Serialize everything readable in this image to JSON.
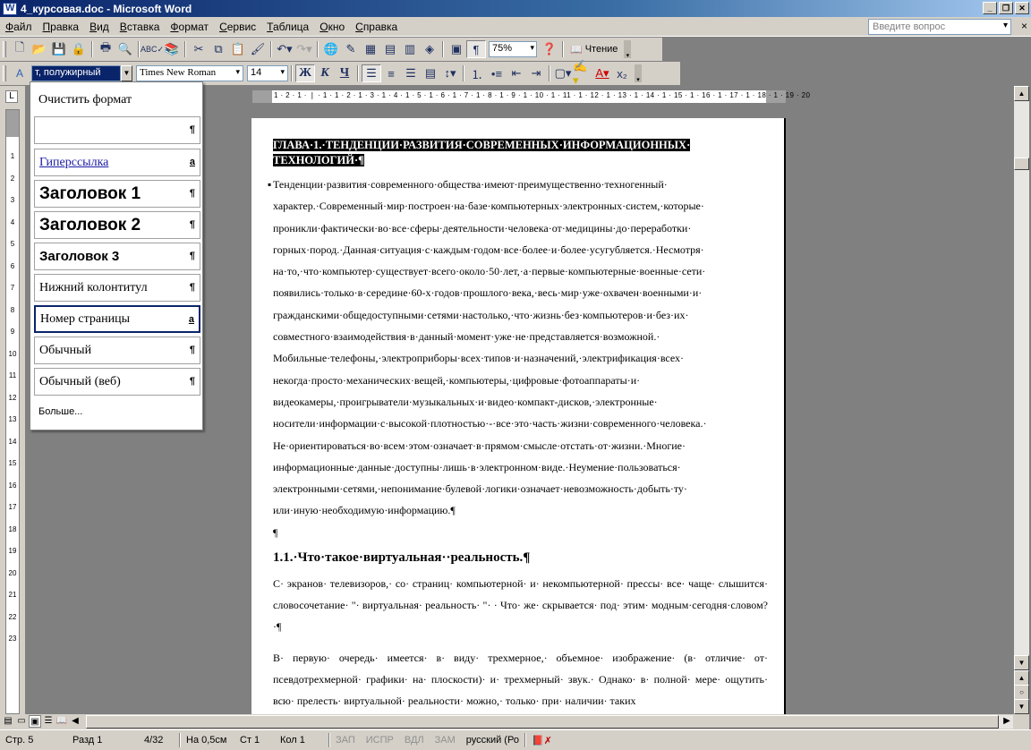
{
  "window": {
    "title": "4_курсовая.doc - Microsoft Word",
    "app_icon_letter": "W"
  },
  "menu": {
    "items": [
      "Файл",
      "Правка",
      "Вид",
      "Вставка",
      "Формат",
      "Сервис",
      "Таблица",
      "Окно",
      "Справка"
    ],
    "ask_placeholder": "Введите вопрос",
    "close_glyph": "×"
  },
  "standard_toolbar": {
    "zoom": "75%",
    "reading_label": "Чтение"
  },
  "format_toolbar": {
    "style_value": "т, полужирный",
    "font_name": "Times New Roman",
    "font_size": "14",
    "bold_letter": "Ж",
    "italic_letter": "К",
    "underline_letter": "Ч"
  },
  "style_panel": {
    "clear_label": "Очистить формат",
    "items": [
      {
        "label": "",
        "mark": "¶"
      },
      {
        "label": "Гиперссылка",
        "mark": "a"
      },
      {
        "label": "Заголовок 1",
        "mark": "¶"
      },
      {
        "label": "Заголовок 2",
        "mark": "¶"
      },
      {
        "label": "Заголовок 3",
        "mark": "¶"
      },
      {
        "label": "Нижний колонтитул",
        "mark": "¶"
      },
      {
        "label": "Номер страницы",
        "mark": "a"
      },
      {
        "label": "Обычный",
        "mark": "¶"
      },
      {
        "label": "Обычный (веб)",
        "mark": "¶"
      }
    ],
    "more_label": "Больше..."
  },
  "ruler": {
    "h_numbers": "1 · 2 · 1 · ❘ · 1 · 1 · 2 · 1 · 3 · 1 · 4 · 1 · 5 · 1 · 6 · 1 · 7 · 1 · 8 · 1 · 9 · 1 · 10 · 1 · 11 · 1 · 12 · 1 · 13 · 1 · 14 · 1 · 15 · 1 · 16 · 1 · 17 · 1 · 18 · 1 · 19 · 20",
    "v_numbers": [
      "1",
      "2",
      "3",
      "4",
      "5",
      "6",
      "7",
      "8",
      "9",
      "10",
      "11",
      "12",
      "13",
      "14",
      "15",
      "16",
      "17",
      "18",
      "19",
      "20",
      "21",
      "22",
      "23"
    ]
  },
  "document": {
    "chapter_title": "ГЛАВА·1.·ТЕНДЕНЦИИ·РАЗВИТИЯ·СОВРЕМЕННЫХ·ИНФОРМАЦИОННЫХ· ТЕХНОЛОГИЙ·¶",
    "para1": "Тенденции·развития·современного·общества·имеют·преимущественно·техногенный· характер.·Современный·мир·построен·на·базе·компьютерных·электронных·систем,·которые· проникли·фактически·во·все·сферы·деятельности·человека·от·медицины·до·переработки· горных·пород.·Данная·ситуация·с·каждым·годом·все·более·и·более·усугубляется.·Несмотря· на·то,·что·компьютер·существует·всего·около·50·лет,·а·первые·компьютерные·военные·сети· появились·только·в·середине·60-х·годов·прошлого·века,·весь·мир·уже·охвачен·военными·и· гражданскими·общедоступными·сетями·настолько,·что·жизнь·без·компьютеров·и·без·их· совместного·взаимодействия·в·данный·момент·уже·не·представляется·возможной.· Мобильные·телефоны,·электроприборы·всех·типов·и·назначений,·электрификация·всех· некогда·просто·механических·вещей,·компьютеры,·цифровые·фотоаппараты·и· видеокамеры,·проигрыватели·музыкальных·и·видео·компакт-дисков,·электронные· носители·информации·с·высокой·плотностью·-·все·это·часть·жизни·современного·человека.· Не·ориентироваться·во·всем·этом·означает·в·прямом·смысле·отстать·от·жизни.·Многие· информационные·данные·доступны·лишь·в·электронном·виде.·Неумение·пользоваться· электронными·сетями,·непонимание·булевой·логики·означает·невозможность·добыть·ту· или·иную·необходимую·информацию.¶",
    "empty_para": "¶",
    "heading": "1.1.·Что·такое·виртуальная··реальность.¶",
    "para2": "С· экранов· телевизоров,· со· страниц· компьютерной· и· некомпьютерной· прессы· все· чаще· слышится· словосочетание· \"· виртуальная· реальность· \"· · Что· же· скрывается· под· этим· модным·сегодня·словом?·¶",
    "para3": "В· первую· очередь· имеется· в· виду· трехмерное,· объемное· изображение· (в· отличие· от· псевдотрехмерной· графики· на· плоскости)· и· трехмерный· звук.· Однако· в· полной· мере· ощутить· всю· прелесть· виртуальной· реальности· можно,· только· при· наличии· таких"
  },
  "status": {
    "page": "Стр. 5",
    "section": "Разд 1",
    "pages": "4/32",
    "position": "На 0,5см",
    "line": "Ст 1",
    "column": "Кол 1",
    "rec": "ЗАП",
    "trk": "ИСПР",
    "ext": "ВДЛ",
    "ovr": "ЗАМ",
    "language": "русский (Ро"
  }
}
